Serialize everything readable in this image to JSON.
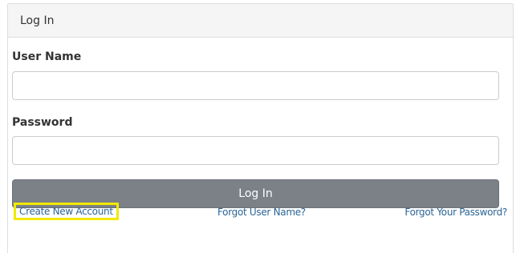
{
  "panel": {
    "title": "Log In"
  },
  "form": {
    "username_label": "User Name",
    "username_value": "",
    "username_placeholder": "",
    "password_label": "Password",
    "password_value": "",
    "password_placeholder": "",
    "submit_label": "Log In"
  },
  "links": {
    "create_account": "Create New Account",
    "forgot_username": "Forgot User Name?",
    "forgot_password": "Forgot Your Password?"
  },
  "colors": {
    "button_bg": "#7b8187",
    "link": "#2a6496",
    "highlight": "#f2e900",
    "heading_bg": "#f5f5f5"
  }
}
